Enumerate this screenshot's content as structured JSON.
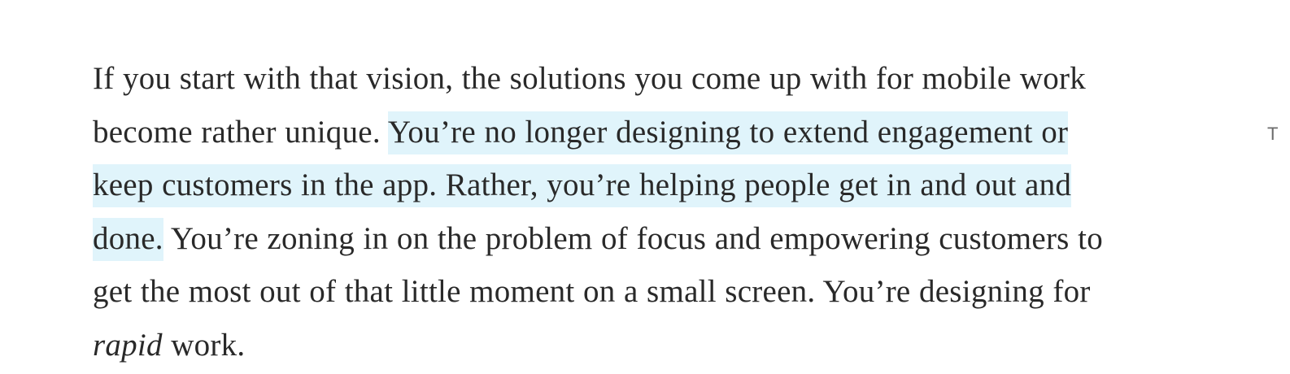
{
  "article": {
    "line1": "If you start with that vision, the solutions you come up with for mobile work",
    "line2_plain": "become rather unique. ",
    "line2_highlight": "You’re no longer designing to extend engagement or",
    "line3_highlight": "keep customers in the app. Rather, you’re helping people get in and out and",
    "line4_highlight": "done.",
    "line4_plain": " You’re zoning in on the problem of focus and empowering customers to",
    "line5": "get the most out of that little moment on a small screen. You’re designing for",
    "line6_italic": "rapid",
    "line6_plain": " work."
  },
  "side_marker": {
    "text": "T"
  },
  "colors": {
    "text": "#292929",
    "highlight": "#e0f4fb"
  }
}
